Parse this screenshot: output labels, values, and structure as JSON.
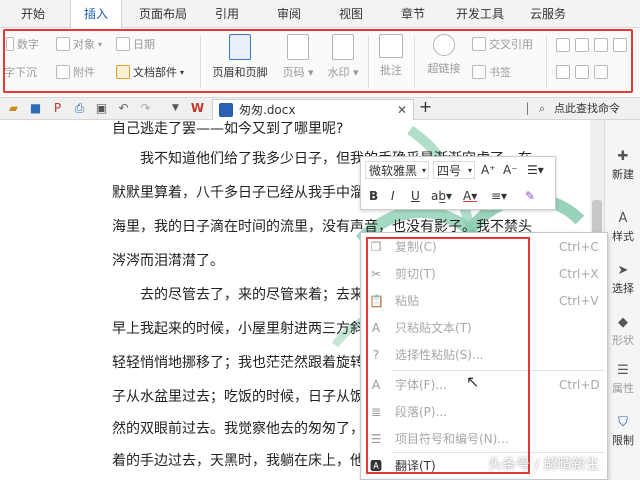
{
  "tabs": [
    "开始",
    "插入",
    "页面布局",
    "引用",
    "审阅",
    "视图",
    "章节",
    "开发工具",
    "云服务"
  ],
  "active_tab": "插入",
  "ribbon": {
    "small_left": [
      "数字",
      "字下沉",
      "对象",
      "附件",
      "日期"
    ],
    "docparts": "文档部件",
    "big": [
      "页眉和页脚",
      "页码",
      "水印",
      "批注",
      "超链接",
      "书签"
    ],
    "cross_ref": "交叉引用"
  },
  "doc_tab": {
    "name": "匆匆.docx"
  },
  "search": {
    "text": "点此查找命令"
  },
  "doc_lines": [
    "自己逃走了罢——如今又到了哪里呢?",
    "　　我不知道他们给了我多少日子，但我的手确乎是渐渐空虚了。在",
    "默默里算着，八千多日子已经从我手中溜去；像针尖上一滴水滴在大",
    "海里，我的日子滴在时间的流里，没有声音，也没有影子。我不禁头",
    "涔涔而泪潸潸了。",
    "　　去的尽管去了，来的尽管来着；去来的中间，又怎样地匆匆呢？",
    "早上我起来的时候，小屋里射进两三方斜斜的太阳。太阳他有脚啊，",
    "轻轻悄悄地挪移了；我也茫茫然跟着旋转。于是——洗手的时候，日",
    "子从水盆里过去；吃饭的时候，日子从饭碗里过去；默默时，便从凝",
    "然的双眼前过去。我觉察他去的匆匆了，伸出手遮挽时，他又从遮挽",
    "着的手边过去，天黑时，我躺在床上，他便伶伶俐俐地从我身上跨过"
  ],
  "mini_toolbar": {
    "font": "微软雅黑",
    "size": "四号"
  },
  "context_menu": [
    {
      "icon": "copy-icon",
      "label": "复制(C)",
      "shortcut": "Ctrl+C"
    },
    {
      "icon": "cut-icon",
      "label": "剪切(T)",
      "shortcut": "Ctrl+X"
    },
    {
      "icon": "paste-icon",
      "label": "粘贴",
      "shortcut": "Ctrl+V"
    },
    {
      "icon": "paste-text-icon",
      "label": "只粘贴文本(T)",
      "shortcut": ""
    },
    {
      "icon": "paste-special-icon",
      "label": "选择性粘贴(S)...",
      "shortcut": ""
    },
    {
      "icon": "font-icon",
      "label": "字体(F)...",
      "shortcut": "Ctrl+D"
    },
    {
      "icon": "paragraph-icon",
      "label": "段落(P)...",
      "shortcut": ""
    },
    {
      "icon": "bullets-icon",
      "label": "项目符号和编号(N)...",
      "shortcut": ""
    },
    {
      "icon": "translate-icon",
      "label": "翻译(T)",
      "shortcut": ""
    }
  ],
  "right_panel": [
    "新建",
    "样式",
    "选择",
    "形状",
    "属性",
    "限制"
  ],
  "watermark": "头条号 / 解晴新生",
  "colors": {
    "accent_red": "#e53935",
    "active_tab": "#1a5fb4"
  }
}
